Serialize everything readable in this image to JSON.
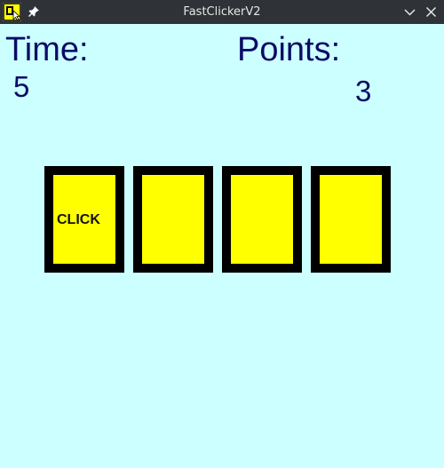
{
  "window": {
    "title": "FastClickerV2",
    "app_icon": "app-logo-icon",
    "pin_icon": "pin-icon",
    "minimize_icon": "chevron-down-icon",
    "close_icon": "close-icon"
  },
  "game": {
    "time_label": "Time:",
    "time_value": "5",
    "points_label": "Points:",
    "points_value": "3",
    "cards": [
      {
        "label": "CLICK",
        "active": true
      },
      {
        "label": "",
        "active": false
      },
      {
        "label": "",
        "active": false
      },
      {
        "label": "",
        "active": false
      }
    ]
  },
  "colors": {
    "background": "#ccffff",
    "text": "#0b0b66",
    "card_border": "#000000",
    "card_fill": "#ffff00",
    "titlebar": "#2f3236"
  }
}
